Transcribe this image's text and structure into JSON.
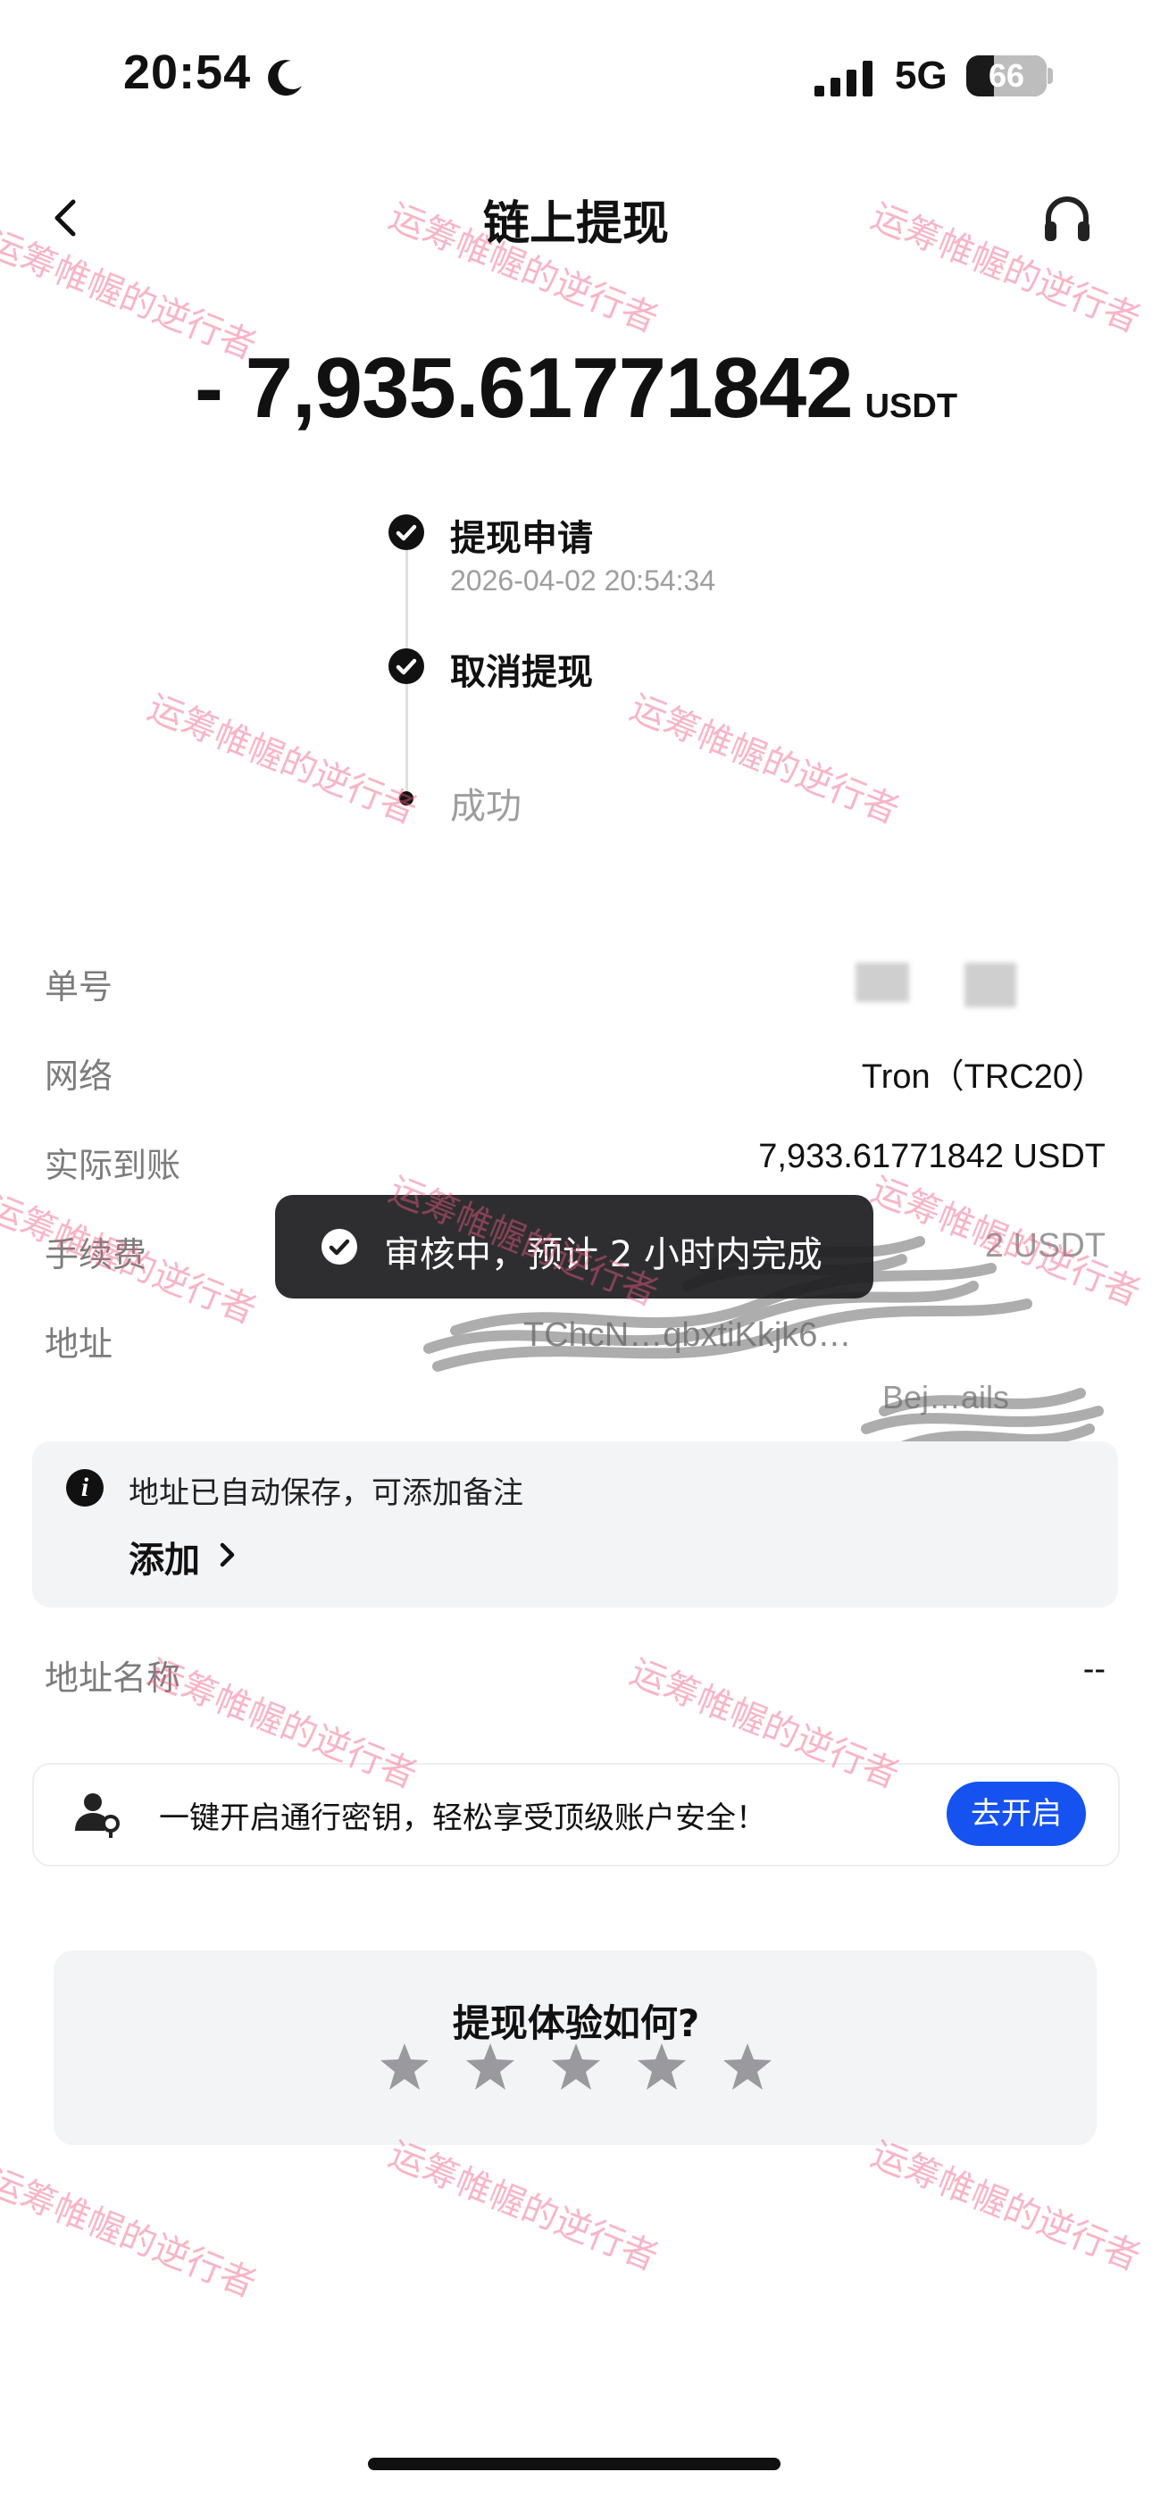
{
  "status_bar": {
    "time": "20:54",
    "network": "5G",
    "battery": "66",
    "battery_level": 0.66
  },
  "header": {
    "title": "链上提现"
  },
  "amount": {
    "value": "- 7,935.61771842",
    "unit": "USDT"
  },
  "timeline": {
    "step1": {
      "label": "提现申请",
      "time": "2026-04-02 20:54:34"
    },
    "step2": {
      "label": "取消提现"
    },
    "step3": {
      "label": "成功"
    }
  },
  "details": {
    "order_no_label": "单号",
    "network_label": "网络",
    "network_value": "Tron（TRC20）",
    "received_label": "实际到账",
    "received_value": "7,933.61771842 USDT",
    "fee_label": "手续费",
    "fee_value": "2 USDT",
    "address_label": "地址",
    "address_value_1": "TChcN…qbxtiKkjk6…",
    "address_value_2": "Bej…ails"
  },
  "info": {
    "text": "地址已自动保存，可添加备注",
    "add": "添加"
  },
  "address_name": {
    "label": "地址名称",
    "value": "--"
  },
  "passkey": {
    "text": "一键开启通行密钥，轻松享受顶级账户安全！",
    "button": "去开启"
  },
  "rating": {
    "title": "提现体验如何?",
    "stars": 5
  },
  "toast": {
    "text": "审核中，预计 2 小时内完成"
  },
  "watermark": "运筹帷幄的逆行者"
}
